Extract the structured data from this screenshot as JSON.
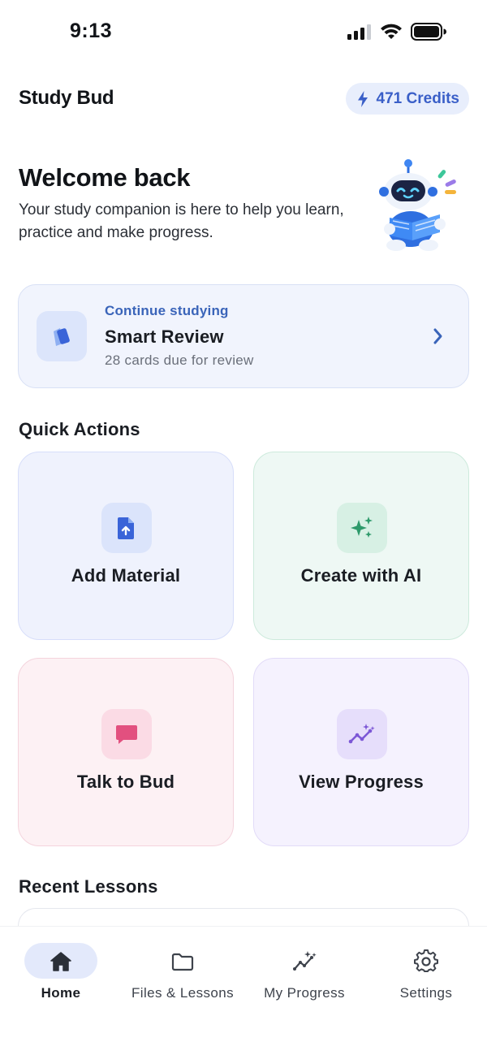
{
  "status_bar": {
    "time": "9:13"
  },
  "header": {
    "title": "Study Bud",
    "credits": "471 Credits",
    "credits_icon": "bolt-icon"
  },
  "welcome": {
    "title": "Welcome back",
    "subtitle": "Your study companion is here to help you learn, practice and make progress.",
    "mascot": "robot-reading-mascot"
  },
  "continue_card": {
    "eyebrow": "Continue studying",
    "title": "Smart Review",
    "subtitle": "28 cards due for review",
    "icon": "flashcards-icon"
  },
  "quick_actions": {
    "title": "Quick Actions",
    "items": [
      {
        "label": "Add Material",
        "icon": "upload-file-icon",
        "accent": "#3a64d8"
      },
      {
        "label": "Create with AI",
        "icon": "sparkles-icon",
        "accent": "#2e9a6b"
      },
      {
        "label": "Talk to Bud",
        "icon": "chat-bubble-icon",
        "accent": "#e2507f"
      },
      {
        "label": "View Progress",
        "icon": "progress-chart-icon",
        "accent": "#7c57d6"
      }
    ]
  },
  "recent": {
    "title": "Recent Lessons"
  },
  "bottom_nav": {
    "items": [
      {
        "label": "Home",
        "icon": "home-icon",
        "active": true
      },
      {
        "label": "Files & Lessons",
        "icon": "folder-icon",
        "active": false
      },
      {
        "label": "My Progress",
        "icon": "progress-chart-icon",
        "active": false
      },
      {
        "label": "Settings",
        "icon": "gear-icon",
        "active": false
      }
    ]
  },
  "colors": {
    "accent_blue": "#3a64b9",
    "text_primary": "#1a1d23",
    "text_secondary": "#6a6f7a"
  }
}
